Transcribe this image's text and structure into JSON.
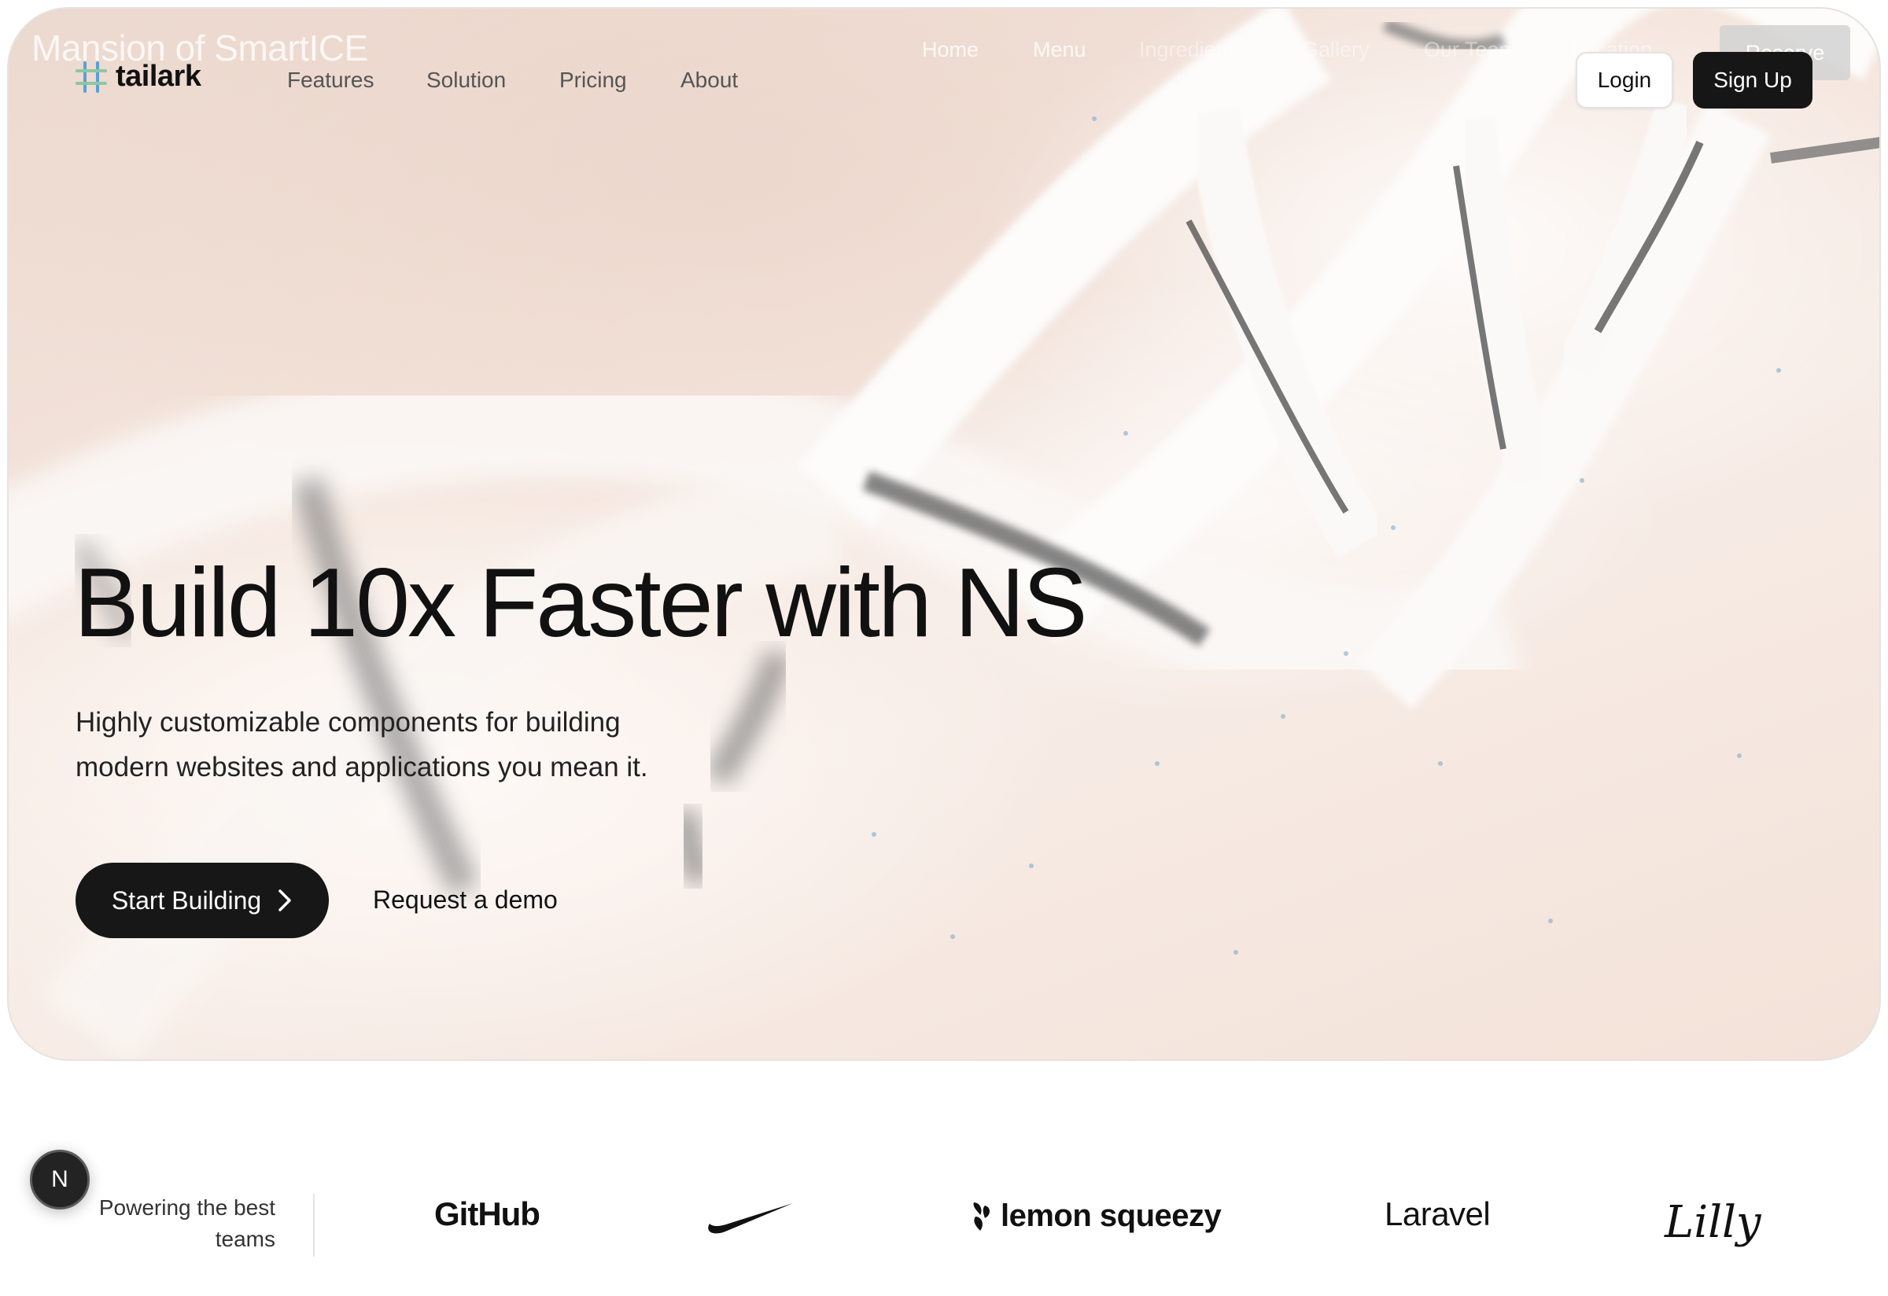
{
  "overlay": {
    "brand": "Mansion of SmartICE",
    "links": [
      "Home",
      "Menu",
      "Ingredients",
      "Gallery",
      "Our Team",
      "Location"
    ],
    "reserve_label": "Reserve"
  },
  "header": {
    "logo_text": "tailark",
    "nav": [
      "Features",
      "Solution",
      "Pricing",
      "About"
    ],
    "login_label": "Login",
    "signup_label": "Sign Up"
  },
  "hero": {
    "title": "Build 10x Faster with NS",
    "subtitle_line1": "Highly customizable components for building",
    "subtitle_line2": "modern websites and applications you mean it.",
    "primary_cta": "Start Building",
    "secondary_cta": "Request a demo"
  },
  "logos": {
    "powered_line1": "Powering the best",
    "powered_line2": "teams",
    "brands": [
      "GitHub",
      "lemon squeezy",
      "Laravel",
      "Lilly"
    ],
    "brand_icons": [
      "nike-swoosh-icon"
    ]
  },
  "badge": {
    "letter": "N"
  },
  "colors": {
    "dark": "#161616",
    "hero_bg": "#f4e4db",
    "logo_accent": "#5aa0d8"
  }
}
